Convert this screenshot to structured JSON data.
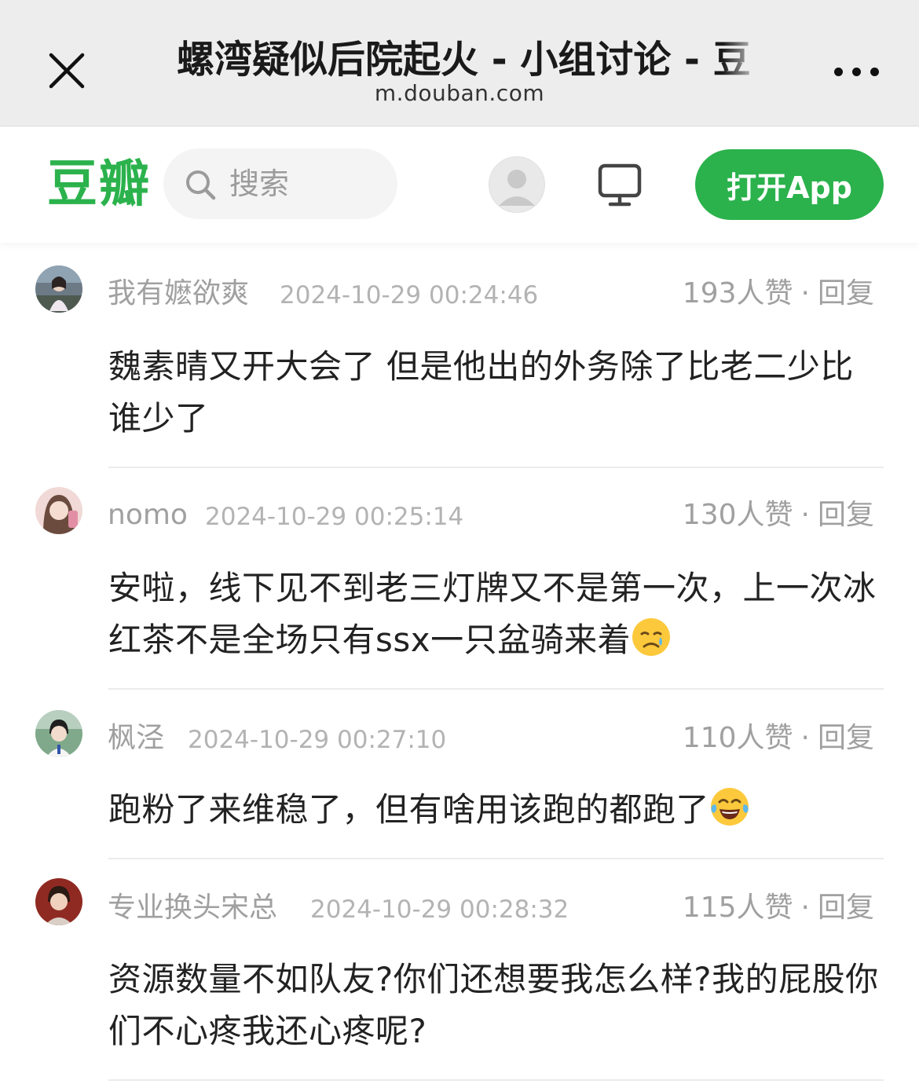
{
  "browser": {
    "title": "螺湾疑似后院起火 - 小组讨论 - 豆",
    "host": "m.douban.com"
  },
  "header": {
    "logo": "豆瓣",
    "search_placeholder": "搜索",
    "open_app_label": "打开App"
  },
  "colors": {
    "brand_green": "#2bb24c",
    "topbar_bg": "#ededed"
  },
  "comments": [
    {
      "user": "我有嬷欲爽",
      "time": "2024-10-29 00:24:46",
      "likes": "193人赞",
      "reply": "回复",
      "text": "魏素晴又开大会了 但是他出的外务除了比老二少比谁少了"
    },
    {
      "user": "nomo",
      "time": "2024-10-29 00:25:14",
      "likes": "130人赞",
      "reply": "回复",
      "text": "安啦，线下见不到老三灯牌又不是第一次，上一次冰红茶不是全场只有ssx一只盆骑来着",
      "emoji": "crying-face-emoji"
    },
    {
      "user": "枫泾",
      "time": "2024-10-29 00:27:10",
      "likes": "110人赞",
      "reply": "回复",
      "text": "跑粉了来维稳了，但有啥用该跑的都跑了",
      "emoji": "tears-of-joy-emoji"
    },
    {
      "user": "专业换头宋总",
      "time": "2024-10-29 00:28:32",
      "likes": "115人赞",
      "reply": "回复",
      "text": "资源数量不如队友?你们还想要我怎么样?我的屁股你们不心疼我还心疼呢?"
    }
  ]
}
